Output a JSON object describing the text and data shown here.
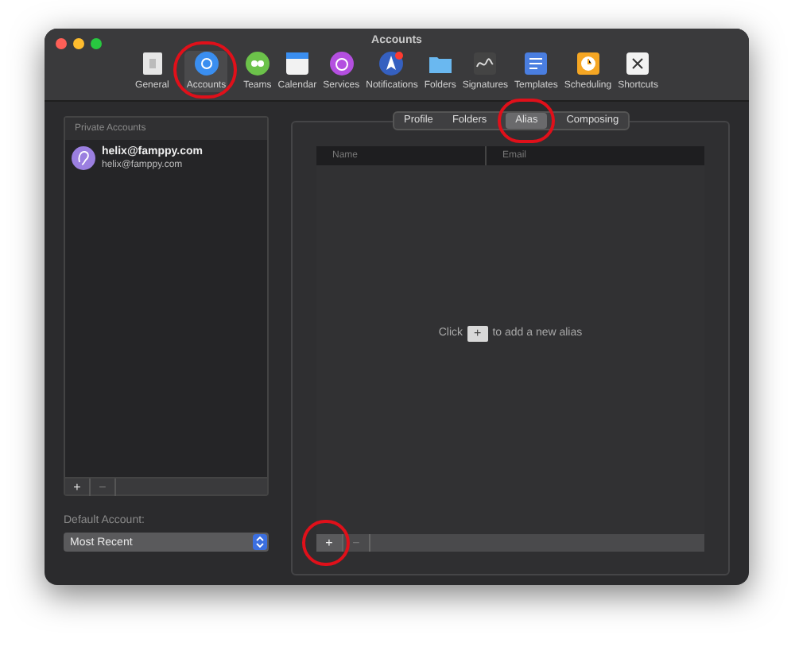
{
  "window": {
    "title": "Accounts"
  },
  "toolbar": [
    {
      "label": "General",
      "selected": false,
      "highlighted": false
    },
    {
      "label": "Accounts",
      "selected": true,
      "highlighted": true
    },
    {
      "label": "Teams",
      "selected": false,
      "highlighted": false
    },
    {
      "label": "Calendar",
      "selected": false,
      "highlighted": false
    },
    {
      "label": "Services",
      "selected": false,
      "highlighted": false
    },
    {
      "label": "Notifications",
      "selected": false,
      "highlighted": false
    },
    {
      "label": "Folders",
      "selected": false,
      "highlighted": false
    },
    {
      "label": "Signatures",
      "selected": false,
      "highlighted": false
    },
    {
      "label": "Templates",
      "selected": false,
      "highlighted": false
    },
    {
      "label": "Scheduling",
      "selected": false,
      "highlighted": false
    },
    {
      "label": "Shortcuts",
      "selected": false,
      "highlighted": false
    }
  ],
  "accounts_panel": {
    "header": "Private Accounts",
    "items": [
      {
        "name": "helix@famppy.com",
        "email": "helix@famppy.com",
        "selected": false
      }
    ],
    "add": "+",
    "remove": "−"
  },
  "default_account": {
    "label": "Default Account:",
    "value": "Most Recent"
  },
  "tabs": [
    {
      "label": "Profile",
      "selected": false,
      "highlighted": false
    },
    {
      "label": "Folders",
      "selected": false,
      "highlighted": false
    },
    {
      "label": "Alias",
      "selected": true,
      "highlighted": true
    },
    {
      "label": "Composing",
      "selected": false,
      "highlighted": false
    }
  ],
  "alias_table": {
    "columns": [
      "Name",
      "Email"
    ],
    "empty_before": "Click",
    "empty_key": "+",
    "empty_after": "to add a new alias",
    "add": "+",
    "add_highlighted": true,
    "remove": "−"
  }
}
